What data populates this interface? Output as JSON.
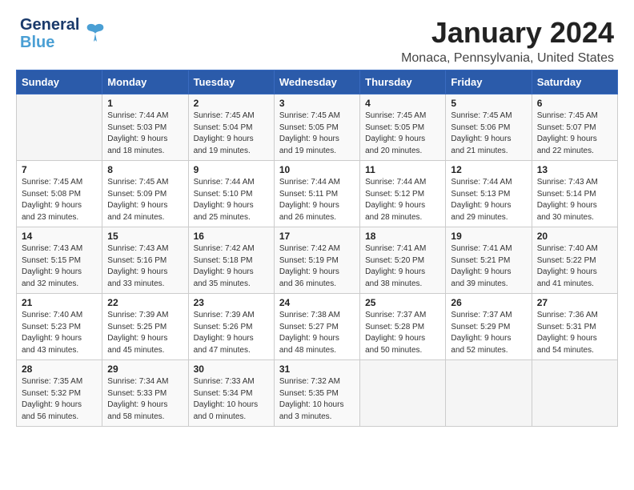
{
  "logo": {
    "text_general": "General",
    "text_blue": "Blue"
  },
  "title": {
    "month_year": "January 2024",
    "location": "Monaca, Pennsylvania, United States"
  },
  "days_of_week": [
    "Sunday",
    "Monday",
    "Tuesday",
    "Wednesday",
    "Thursday",
    "Friday",
    "Saturday"
  ],
  "weeks": [
    [
      {
        "day": "",
        "info": ""
      },
      {
        "day": "1",
        "info": "Sunrise: 7:44 AM\nSunset: 5:03 PM\nDaylight: 9 hours\nand 18 minutes."
      },
      {
        "day": "2",
        "info": "Sunrise: 7:45 AM\nSunset: 5:04 PM\nDaylight: 9 hours\nand 19 minutes."
      },
      {
        "day": "3",
        "info": "Sunrise: 7:45 AM\nSunset: 5:05 PM\nDaylight: 9 hours\nand 19 minutes."
      },
      {
        "day": "4",
        "info": "Sunrise: 7:45 AM\nSunset: 5:05 PM\nDaylight: 9 hours\nand 20 minutes."
      },
      {
        "day": "5",
        "info": "Sunrise: 7:45 AM\nSunset: 5:06 PM\nDaylight: 9 hours\nand 21 minutes."
      },
      {
        "day": "6",
        "info": "Sunrise: 7:45 AM\nSunset: 5:07 PM\nDaylight: 9 hours\nand 22 minutes."
      }
    ],
    [
      {
        "day": "7",
        "info": "Sunrise: 7:45 AM\nSunset: 5:08 PM\nDaylight: 9 hours\nand 23 minutes."
      },
      {
        "day": "8",
        "info": "Sunrise: 7:45 AM\nSunset: 5:09 PM\nDaylight: 9 hours\nand 24 minutes."
      },
      {
        "day": "9",
        "info": "Sunrise: 7:44 AM\nSunset: 5:10 PM\nDaylight: 9 hours\nand 25 minutes."
      },
      {
        "day": "10",
        "info": "Sunrise: 7:44 AM\nSunset: 5:11 PM\nDaylight: 9 hours\nand 26 minutes."
      },
      {
        "day": "11",
        "info": "Sunrise: 7:44 AM\nSunset: 5:12 PM\nDaylight: 9 hours\nand 28 minutes."
      },
      {
        "day": "12",
        "info": "Sunrise: 7:44 AM\nSunset: 5:13 PM\nDaylight: 9 hours\nand 29 minutes."
      },
      {
        "day": "13",
        "info": "Sunrise: 7:43 AM\nSunset: 5:14 PM\nDaylight: 9 hours\nand 30 minutes."
      }
    ],
    [
      {
        "day": "14",
        "info": "Sunrise: 7:43 AM\nSunset: 5:15 PM\nDaylight: 9 hours\nand 32 minutes."
      },
      {
        "day": "15",
        "info": "Sunrise: 7:43 AM\nSunset: 5:16 PM\nDaylight: 9 hours\nand 33 minutes."
      },
      {
        "day": "16",
        "info": "Sunrise: 7:42 AM\nSunset: 5:18 PM\nDaylight: 9 hours\nand 35 minutes."
      },
      {
        "day": "17",
        "info": "Sunrise: 7:42 AM\nSunset: 5:19 PM\nDaylight: 9 hours\nand 36 minutes."
      },
      {
        "day": "18",
        "info": "Sunrise: 7:41 AM\nSunset: 5:20 PM\nDaylight: 9 hours\nand 38 minutes."
      },
      {
        "day": "19",
        "info": "Sunrise: 7:41 AM\nSunset: 5:21 PM\nDaylight: 9 hours\nand 39 minutes."
      },
      {
        "day": "20",
        "info": "Sunrise: 7:40 AM\nSunset: 5:22 PM\nDaylight: 9 hours\nand 41 minutes."
      }
    ],
    [
      {
        "day": "21",
        "info": "Sunrise: 7:40 AM\nSunset: 5:23 PM\nDaylight: 9 hours\nand 43 minutes."
      },
      {
        "day": "22",
        "info": "Sunrise: 7:39 AM\nSunset: 5:25 PM\nDaylight: 9 hours\nand 45 minutes."
      },
      {
        "day": "23",
        "info": "Sunrise: 7:39 AM\nSunset: 5:26 PM\nDaylight: 9 hours\nand 47 minutes."
      },
      {
        "day": "24",
        "info": "Sunrise: 7:38 AM\nSunset: 5:27 PM\nDaylight: 9 hours\nand 48 minutes."
      },
      {
        "day": "25",
        "info": "Sunrise: 7:37 AM\nSunset: 5:28 PM\nDaylight: 9 hours\nand 50 minutes."
      },
      {
        "day": "26",
        "info": "Sunrise: 7:37 AM\nSunset: 5:29 PM\nDaylight: 9 hours\nand 52 minutes."
      },
      {
        "day": "27",
        "info": "Sunrise: 7:36 AM\nSunset: 5:31 PM\nDaylight: 9 hours\nand 54 minutes."
      }
    ],
    [
      {
        "day": "28",
        "info": "Sunrise: 7:35 AM\nSunset: 5:32 PM\nDaylight: 9 hours\nand 56 minutes."
      },
      {
        "day": "29",
        "info": "Sunrise: 7:34 AM\nSunset: 5:33 PM\nDaylight: 9 hours\nand 58 minutes."
      },
      {
        "day": "30",
        "info": "Sunrise: 7:33 AM\nSunset: 5:34 PM\nDaylight: 10 hours\nand 0 minutes."
      },
      {
        "day": "31",
        "info": "Sunrise: 7:32 AM\nSunset: 5:35 PM\nDaylight: 10 hours\nand 3 minutes."
      },
      {
        "day": "",
        "info": ""
      },
      {
        "day": "",
        "info": ""
      },
      {
        "day": "",
        "info": ""
      }
    ]
  ]
}
